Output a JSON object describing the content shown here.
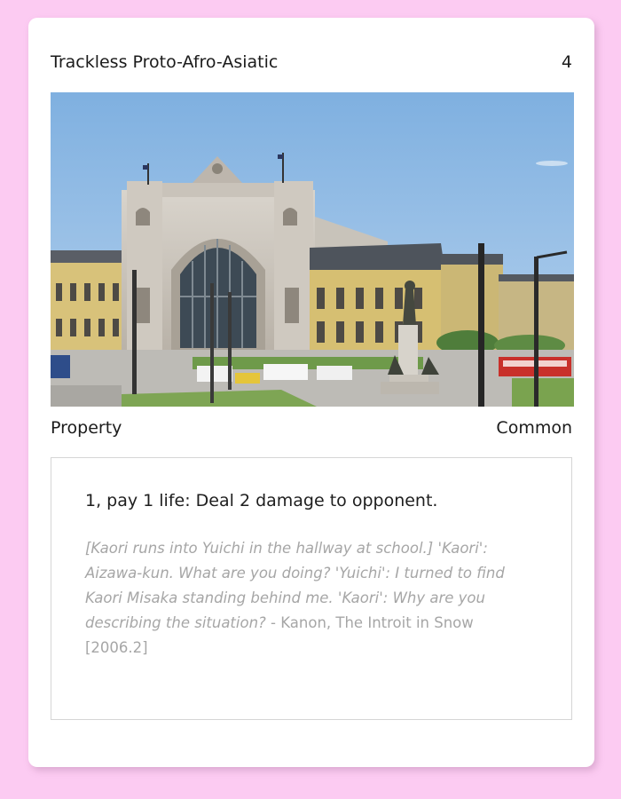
{
  "card": {
    "name": "Trackless Proto-Afro-Asiatic",
    "cost": "4",
    "type": "Property",
    "rarity": "Common",
    "rules_text": "1, pay 1 life: Deal 2 damage to opponent.",
    "flavor_quote": "[Kaori runs into Yuichi in the hallway at school.] 'Kaori': Aizawa-kun. What are you doing? 'Yuichi': I turned to find Kaori Misaka standing behind me. 'Kaori': Why are you describing the situation?",
    "flavor_source": " - Kanon, The Introit in Snow [2006.2]"
  },
  "colors": {
    "page_background": "#fccbf2",
    "card_background": "#ffffff",
    "flavor_text": "#a6a6a6"
  }
}
